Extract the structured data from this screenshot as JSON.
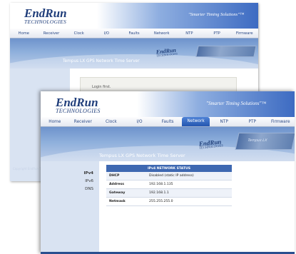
{
  "brand": {
    "line1": "EndRun",
    "line2": "TECHNOLOGIES",
    "slogan": "\"Smarter Timing Solutions\"™"
  },
  "back_window": {
    "tabs": [
      {
        "label": "Home",
        "active": true
      },
      {
        "label": "Receiver",
        "active": false
      },
      {
        "label": "Clock",
        "active": false
      },
      {
        "label": "I/O",
        "active": false
      },
      {
        "label": "Faults",
        "active": false
      },
      {
        "label": "Network",
        "active": false
      },
      {
        "label": "NTP",
        "active": false
      },
      {
        "label": "PTP",
        "active": false
      },
      {
        "label": "Firmware",
        "active": false
      }
    ],
    "banner_title": "Tempus LX GPS Network Time Server",
    "message": "Login first.",
    "copyright": "Copyright EndRun Technologies"
  },
  "front_window": {
    "tabs": [
      {
        "label": "Home",
        "active": false
      },
      {
        "label": "Receiver",
        "active": false
      },
      {
        "label": "Clock",
        "active": false
      },
      {
        "label": "I/O",
        "active": false
      },
      {
        "label": "Faults",
        "active": false
      },
      {
        "label": "Network",
        "active": true
      },
      {
        "label": "NTP",
        "active": false
      },
      {
        "label": "PTP",
        "active": false
      },
      {
        "label": "Firmware",
        "active": false
      }
    ],
    "banner_title": "Tempus LX GPS Network Time Server",
    "product_label": "Tempus LX",
    "sidebar": [
      {
        "label": "IPv4",
        "active": true
      },
      {
        "label": "IPv6",
        "active": false
      },
      {
        "label": "DNS",
        "active": false
      }
    ],
    "table": {
      "title": "IPv4 NETWORK STATUS",
      "rows": [
        {
          "key": "DHCP",
          "value": "Disabled (static IP address)"
        },
        {
          "key": "Address",
          "value": "192.168.1.135"
        },
        {
          "key": "Gateway",
          "value": "192.168.1.1"
        },
        {
          "key": "Netmask",
          "value": "255.255.255.0"
        }
      ]
    }
  },
  "colors": {
    "nav_active": "#2f62bd",
    "brand_blue": "#1f3d7a",
    "banner": "#7f9fd3",
    "sidebar": "#d9e3f2"
  }
}
